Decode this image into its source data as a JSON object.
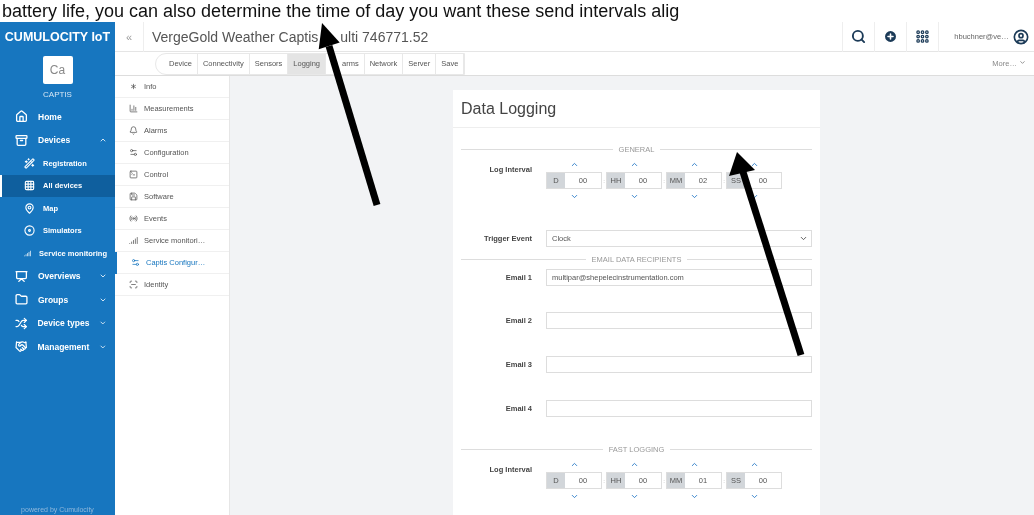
{
  "caption": "battery life, you can also determine the time of day you want these send intervals alig",
  "sidebar": {
    "brand": "CUMULOCITY IoT",
    "tenant_initials": "Ca",
    "tenant": "CAPTIS",
    "footer": "powered by Cumulocity",
    "items": [
      {
        "label": "Home",
        "kind": "link",
        "selected": false
      },
      {
        "label": "Devices",
        "kind": "group",
        "expanded": true,
        "selected": false,
        "children": [
          {
            "label": "Registration",
            "selected": false
          },
          {
            "label": "All devices",
            "selected": true
          },
          {
            "label": "Map",
            "selected": false
          },
          {
            "label": "Simulators",
            "selected": false
          },
          {
            "label": "Service monitoring",
            "selected": false
          }
        ]
      },
      {
        "label": "Overviews",
        "kind": "group",
        "expanded": false,
        "selected": false
      },
      {
        "label": "Groups",
        "kind": "group",
        "expanded": false,
        "selected": false
      },
      {
        "label": "Device types",
        "kind": "group",
        "expanded": false,
        "selected": false
      },
      {
        "label": "Management",
        "kind": "group",
        "expanded": false,
        "selected": false
      }
    ]
  },
  "header": {
    "collapse": "«",
    "title": "VergeGold Weather Captis",
    "title_rest": "ulti 746771.52",
    "user": "hbuchner@ve…"
  },
  "tabs": [
    {
      "label": "Device",
      "selected": false
    },
    {
      "label": "Connectivity",
      "selected": false
    },
    {
      "label": "Sensors",
      "selected": false
    },
    {
      "label": "Logging",
      "selected": true
    },
    {
      "label": "arms",
      "selected": false
    },
    {
      "label": "Network",
      "selected": false
    },
    {
      "label": "Server",
      "selected": false
    },
    {
      "label": "Save",
      "selected": false
    }
  ],
  "more": "More…",
  "nav": [
    {
      "label": "Info",
      "selected": false
    },
    {
      "label": "Measurements",
      "selected": false
    },
    {
      "label": "Alarms",
      "selected": false
    },
    {
      "label": "Configuration",
      "selected": false
    },
    {
      "label": "Control",
      "selected": false
    },
    {
      "label": "Software",
      "selected": false
    },
    {
      "label": "Events",
      "selected": false
    },
    {
      "label": "Service monitori…",
      "selected": false
    },
    {
      "label": "Captis Configur…",
      "selected": true
    },
    {
      "label": "Identity",
      "selected": false
    }
  ],
  "form": {
    "title": "Data Logging",
    "sections": [
      {
        "heading": "GENERAL",
        "fields": [
          {
            "kind": "interval",
            "label": "Log Interval",
            "separator": ":",
            "units": [
              {
                "unit": "D",
                "value": "00"
              },
              {
                "unit": "HH",
                "value": "00"
              },
              {
                "unit": "MM",
                "value": "02"
              },
              {
                "unit": "SS",
                "value": "00"
              }
            ]
          },
          {
            "kind": "select",
            "label": "Trigger Event",
            "value": "Clock"
          }
        ]
      },
      {
        "heading": "EMAIL DATA RECIPIENTS",
        "fields": [
          {
            "kind": "email",
            "label": "Email 1",
            "value": "multipar@shepelecinstrumentation.com"
          },
          {
            "kind": "email",
            "label": "Email 2"
          },
          {
            "kind": "email",
            "label": "Email 3"
          },
          {
            "kind": "email",
            "label": "Email 4"
          }
        ]
      },
      {
        "heading": "FAST LOGGING",
        "fields": [
          {
            "kind": "interval",
            "label": "Log Interval",
            "separator": ":",
            "units": [
              {
                "unit": "D",
                "value": "00"
              },
              {
                "unit": "HH",
                "value": "00"
              },
              {
                "unit": "MM",
                "value": "01"
              },
              {
                "unit": "SS",
                "value": "00"
              }
            ]
          }
        ]
      }
    ]
  }
}
